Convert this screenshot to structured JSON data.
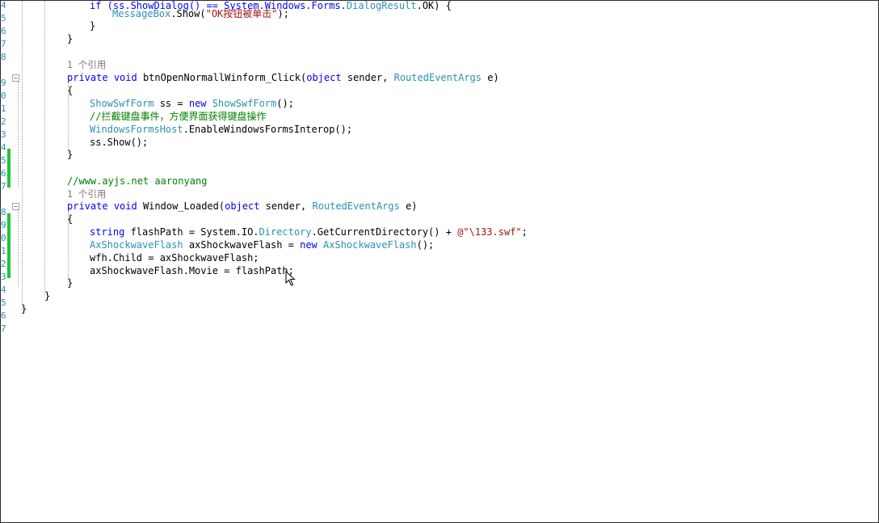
{
  "gutter": {
    "line_numbers": [
      "4",
      "5",
      "6",
      "7",
      "8",
      "9",
      "0",
      "1",
      "2",
      "3",
      "4",
      "5",
      "6",
      "7",
      "8",
      "9",
      "0",
      "1",
      "2",
      "3",
      "4",
      "5",
      "6",
      "7"
    ]
  },
  "code": {
    "l01": {
      "a": "if (ss.ShowDialog() == System.Windows.Forms.",
      "b": "DialogResult",
      "c": ".OK) {"
    },
    "l02": {
      "a": "MessageBox",
      "b": ".Show(",
      "c": "\"OK按钮被单击\"",
      "d": ");"
    },
    "l03": {
      "a": "}"
    },
    "l04": {
      "a": "}"
    },
    "l06": {
      "a": "1 个引用"
    },
    "l07": {
      "a": "private",
      "b": " ",
      "c": "void",
      "d": " btnOpenNormallWinform_Click(",
      "e": "object",
      "f": " sender, ",
      "g": "RoutedEventArgs",
      "h": " e)"
    },
    "l08": {
      "a": "{"
    },
    "l09": {
      "a": "ShowSwfForm",
      "b": " ss = ",
      "c": "new",
      "d": " ",
      "e": "ShowSwfForm",
      "f": "();"
    },
    "l10": {
      "a": "//拦截键盘事件，方便界面获得键盘操作"
    },
    "l11": {
      "a": "WindowsFormsHost",
      "b": ".EnableWindowsFormsInterop();"
    },
    "l12": {
      "a": "ss.Show();"
    },
    "l13": {
      "a": "}"
    },
    "l15": {
      "a": "//www.ayjs.net aaronyang"
    },
    "l16": {
      "a": "1 个引用"
    },
    "l17": {
      "a": "private",
      "b": " ",
      "c": "void",
      "d": " Window_Loaded(",
      "e": "object",
      "f": " sender, ",
      "g": "RoutedEventArgs",
      "h": " e)"
    },
    "l18": {
      "a": "{"
    },
    "l19": {
      "a": "string",
      "b": " flashPath = System.IO.",
      "c": "Directory",
      "d": ".GetCurrentDirectory() + ",
      "e": "@\"\\133.swf\"",
      "f": ";"
    },
    "l20": {
      "a": "AxShockwaveFlash",
      "b": " axShockwaveFlash = ",
      "c": "new",
      "d": " ",
      "e": "AxShockwaveFlash",
      "f": "();"
    },
    "l21": {
      "a": "wfh.Child = axShockwaveFlash;"
    },
    "l22": {
      "a": "axShockwaveFlash.Movie = flashPath;"
    },
    "l23": {
      "a": "}"
    },
    "l24": {
      "a": "}"
    },
    "l25": {
      "a": "}"
    }
  },
  "icons": {
    "fold": "collapse-minus-icon",
    "cursor": "mouse-pointer-icon"
  },
  "colors": {
    "keyword": "#0000ff",
    "type": "#2b91af",
    "string": "#a31515",
    "comment": "#008000",
    "codelens": "#7a7a7a",
    "change_bar": "#22c436"
  }
}
